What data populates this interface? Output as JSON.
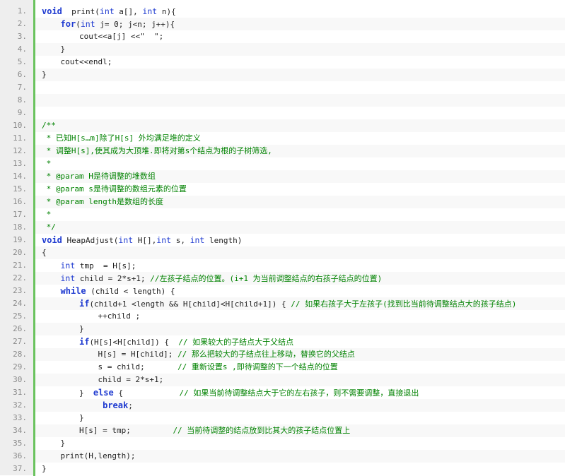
{
  "editor": {
    "line_numbers": [
      "1.",
      "2.",
      "3.",
      "4.",
      "5.",
      "6.",
      "7.",
      "8.",
      "9.",
      "10.",
      "11.",
      "12.",
      "13.",
      "14.",
      "15.",
      "16.",
      "17.",
      "18.",
      "19.",
      "20.",
      "21.",
      "22.",
      "23.",
      "24.",
      "25.",
      "26.",
      "27.",
      "28.",
      "29.",
      "30.",
      "31.",
      "32.",
      "33.",
      "34.",
      "35.",
      "36.",
      "37."
    ],
    "colors": {
      "keyword": "#1e3ad0",
      "comment": "#008200",
      "text": "#222222",
      "gutter_bg": "#eeeeee",
      "gutter_text": "#8a8a8a",
      "accent_bar": "#6ac35e",
      "alt_row": "#f8f8f8"
    },
    "lines": [
      [
        [
          "kw",
          "void"
        ],
        [
          "",
          "  print("
        ],
        [
          "ty",
          "int"
        ],
        [
          "",
          " a[], "
        ],
        [
          "ty",
          "int"
        ],
        [
          "",
          " n){"
        ]
      ],
      [
        [
          "",
          "    "
        ],
        [
          "kw",
          "for"
        ],
        [
          "",
          "("
        ],
        [
          "ty",
          "int"
        ],
        [
          "",
          " j= 0; j<n; j++){"
        ]
      ],
      [
        [
          "",
          "        cout<<a[j] <<\"  \";"
        ]
      ],
      [
        [
          "",
          "    }"
        ]
      ],
      [
        [
          "",
          "    cout<<endl;"
        ]
      ],
      [
        [
          "",
          "}"
        ]
      ],
      [],
      [],
      [],
      [
        [
          "cm",
          "/**"
        ]
      ],
      [
        [
          "cm",
          " * 已知H[s…m]除了H[s] 外均满足堆的定义"
        ]
      ],
      [
        [
          "cm",
          " * 调整H[s],使其成为大顶堆.即将对第s个结点为根的子树筛选,"
        ]
      ],
      [
        [
          "cm",
          " *"
        ]
      ],
      [
        [
          "cm",
          " * @param H是待调整的堆数组"
        ]
      ],
      [
        [
          "cm",
          " * @param s是待调整的数组元素的位置"
        ]
      ],
      [
        [
          "cm",
          " * @param length是数组的长度"
        ]
      ],
      [
        [
          "cm",
          " *"
        ]
      ],
      [
        [
          "cm",
          " */"
        ]
      ],
      [
        [
          "kw",
          "void"
        ],
        [
          "",
          " HeapAdjust("
        ],
        [
          "ty",
          "int"
        ],
        [
          "",
          " H[],"
        ],
        [
          "ty",
          "int"
        ],
        [
          "",
          " s, "
        ],
        [
          "ty",
          "int"
        ],
        [
          "",
          " length)"
        ]
      ],
      [
        [
          "",
          "{"
        ]
      ],
      [
        [
          "",
          "    "
        ],
        [
          "ty",
          "int"
        ],
        [
          "",
          " tmp  = H[s];"
        ]
      ],
      [
        [
          "",
          "    "
        ],
        [
          "ty",
          "int"
        ],
        [
          "",
          " child = 2*s+1; "
        ],
        [
          "cm",
          "//左孩子结点的位置。(i+1 为当前调整结点的右孩子结点的位置)"
        ]
      ],
      [
        [
          "",
          "    "
        ],
        [
          "kw",
          "while"
        ],
        [
          "",
          " (child < length) {"
        ]
      ],
      [
        [
          "",
          "        "
        ],
        [
          "kw",
          "if"
        ],
        [
          "",
          "(child+1 <length && H[child]<H[child+1]) { "
        ],
        [
          "cm",
          "// 如果右孩子大于左孩子(找到比当前待调整结点大的孩子结点)"
        ]
      ],
      [
        [
          "",
          "            ++child ;"
        ]
      ],
      [
        [
          "",
          "        }"
        ]
      ],
      [
        [
          "",
          "        "
        ],
        [
          "kw",
          "if"
        ],
        [
          "",
          "(H[s]<H[child]) {  "
        ],
        [
          "cm",
          "// 如果较大的子结点大于父结点"
        ]
      ],
      [
        [
          "",
          "            H[s] = H[child]; "
        ],
        [
          "cm",
          "// 那么把较大的子结点往上移动，替换它的父结点"
        ]
      ],
      [
        [
          "",
          "            s = child;       "
        ],
        [
          "cm",
          "// 重新设置s ,即待调整的下一个结点的位置"
        ]
      ],
      [
        [
          "",
          "            child = 2*s+1;"
        ]
      ],
      [
        [
          "",
          "        }  "
        ],
        [
          "kw",
          "else"
        ],
        [
          "",
          " {            "
        ],
        [
          "cm",
          "// 如果当前待调整结点大于它的左右孩子，则不需要调整，直接退出"
        ]
      ],
      [
        [
          "",
          "             "
        ],
        [
          "kw",
          "break"
        ],
        [
          "",
          ";"
        ]
      ],
      [
        [
          "",
          "        }"
        ]
      ],
      [
        [
          "",
          "        H[s] = tmp;         "
        ],
        [
          "cm",
          "// 当前待调整的结点放到比其大的孩子结点位置上"
        ]
      ],
      [
        [
          "",
          "    }"
        ]
      ],
      [
        [
          "",
          "    print(H,length);"
        ]
      ],
      [
        [
          "",
          "}"
        ]
      ]
    ]
  }
}
